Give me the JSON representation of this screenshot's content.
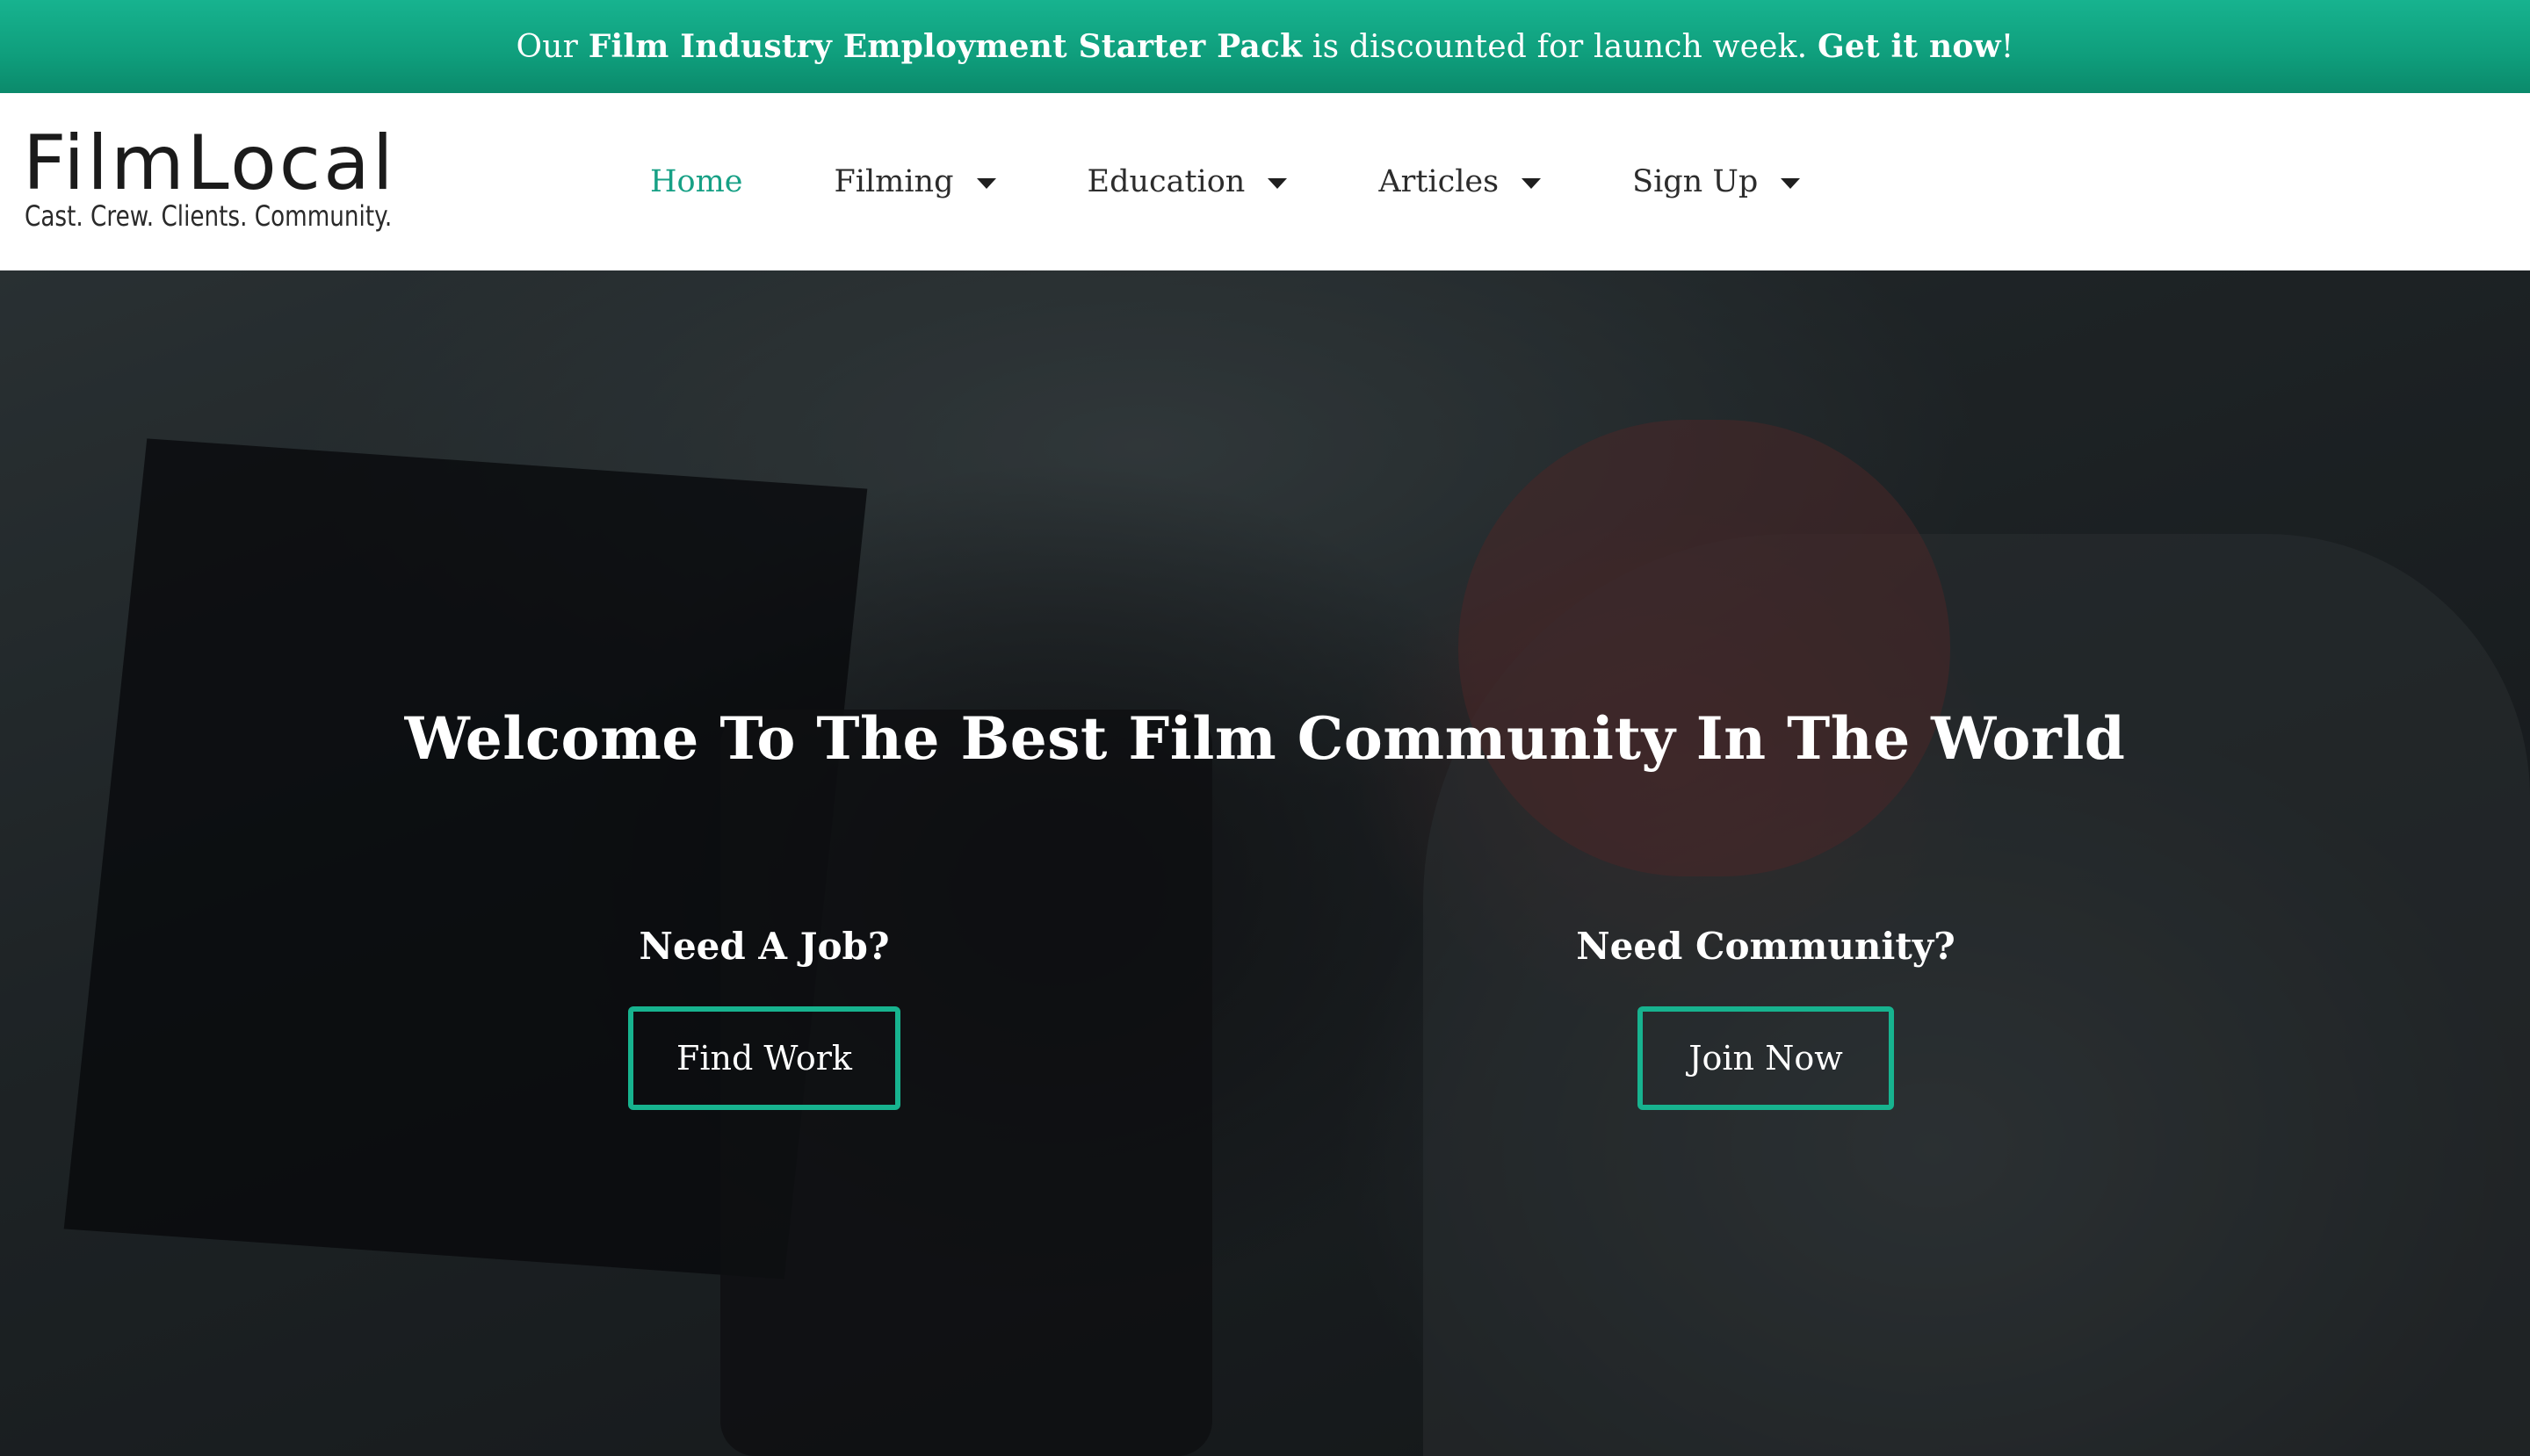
{
  "promo": {
    "prefix": "Our ",
    "product": "Film Industry Employment Starter Pack",
    "middle": " is discounted for launch week. ",
    "cta": "Get it now",
    "suffix": "!"
  },
  "brand": {
    "name": "FilmLocal",
    "tagline": "Cast. Crew. Clients. Community."
  },
  "nav": {
    "items": [
      {
        "label": "Home",
        "active": true,
        "has_dropdown": false
      },
      {
        "label": "Filming",
        "active": false,
        "has_dropdown": true
      },
      {
        "label": "Education",
        "active": false,
        "has_dropdown": true
      },
      {
        "label": "Articles",
        "active": false,
        "has_dropdown": true
      },
      {
        "label": "Sign Up",
        "active": false,
        "has_dropdown": true
      }
    ]
  },
  "hero": {
    "title": "Welcome To The Best Film Community In The World",
    "job": {
      "heading": "Need A Job?",
      "button": "Find Work"
    },
    "community": {
      "heading": "Need Community?",
      "button": "Join Now"
    }
  },
  "colors": {
    "accent": "#16a085",
    "promo_bg": "#0f9e7c",
    "header_bg": "#ffffff",
    "button_border": "#17b38f"
  }
}
